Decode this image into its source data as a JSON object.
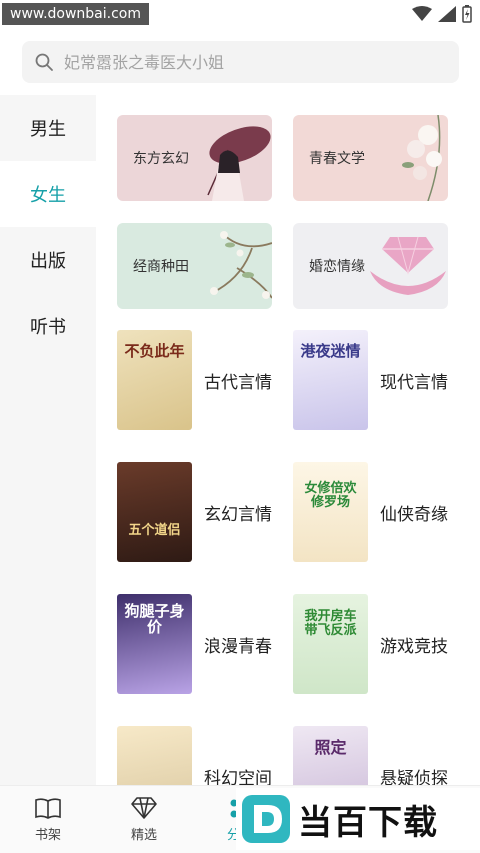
{
  "watermark": "www.downbai.com",
  "search": {
    "placeholder": "妃常嚣张之毒医大小姐"
  },
  "rail": [
    {
      "label": "男生",
      "active": false
    },
    {
      "label": "女生",
      "active": true
    },
    {
      "label": "出版",
      "active": false
    },
    {
      "label": "听书",
      "active": false
    }
  ],
  "banners": [
    {
      "label": "东方玄幻",
      "bg": "#ecd6d8"
    },
    {
      "label": "青春文学",
      "bg": "#f2d9d6"
    },
    {
      "label": "经商种田",
      "bg": "#d9eae0"
    },
    {
      "label": "婚恋情缘",
      "bg": "#efeff2"
    }
  ],
  "books": [
    {
      "label": "古代言情",
      "cover_text": "不负此年"
    },
    {
      "label": "现代言情",
      "cover_text": "港夜迷情"
    },
    {
      "label": "玄幻言情",
      "cover_text": "五个道侣"
    },
    {
      "label": "仙侠奇缘",
      "cover_text": "女修倍欢修罗场"
    },
    {
      "label": "浪漫青春",
      "cover_text": "狗腿子身价"
    },
    {
      "label": "游戏竞技",
      "cover_text": "我开房车带飞反派"
    },
    {
      "label": "科幻空间",
      "cover_text": ""
    },
    {
      "label": "悬疑侦探",
      "cover_text": "照定"
    }
  ],
  "bottomnav": [
    {
      "label": "书架",
      "icon": "book-icon",
      "active": false
    },
    {
      "label": "精选",
      "icon": "diamond-icon",
      "active": false
    },
    {
      "label": "分类",
      "icon": "category-icon",
      "active": true
    }
  ],
  "logo": {
    "text": "当百下载"
  },
  "colors": {
    "accent": "#16a0a8",
    "rail_bg": "#f6f6f6",
    "search_bg": "#f3f3f3"
  }
}
